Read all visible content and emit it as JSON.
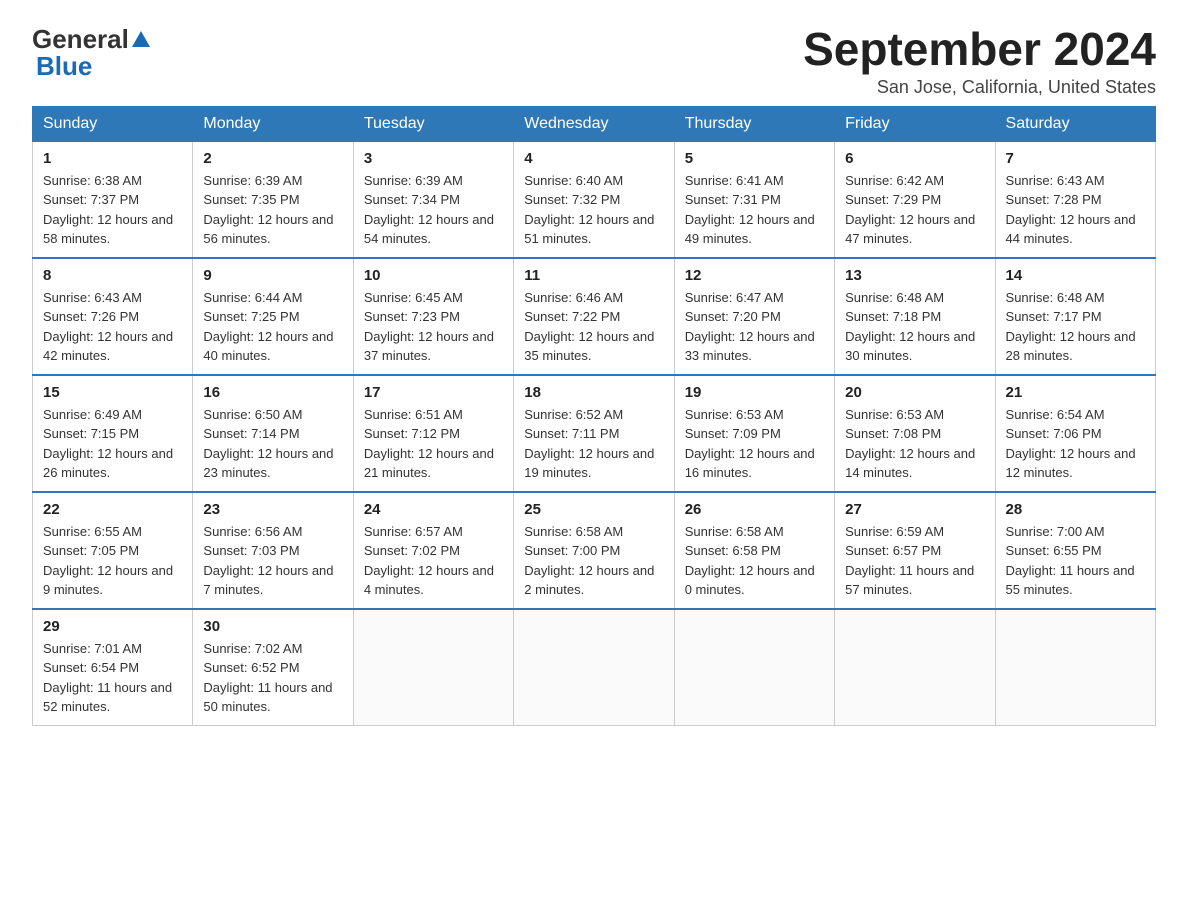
{
  "header": {
    "logo_general": "General",
    "logo_blue": "Blue",
    "month_title": "September 2024",
    "location": "San Jose, California, United States"
  },
  "days_of_week": [
    "Sunday",
    "Monday",
    "Tuesday",
    "Wednesday",
    "Thursday",
    "Friday",
    "Saturday"
  ],
  "weeks": [
    [
      {
        "num": "1",
        "sunrise": "6:38 AM",
        "sunset": "7:37 PM",
        "daylight": "12 hours and 58 minutes."
      },
      {
        "num": "2",
        "sunrise": "6:39 AM",
        "sunset": "7:35 PM",
        "daylight": "12 hours and 56 minutes."
      },
      {
        "num": "3",
        "sunrise": "6:39 AM",
        "sunset": "7:34 PM",
        "daylight": "12 hours and 54 minutes."
      },
      {
        "num": "4",
        "sunrise": "6:40 AM",
        "sunset": "7:32 PM",
        "daylight": "12 hours and 51 minutes."
      },
      {
        "num": "5",
        "sunrise": "6:41 AM",
        "sunset": "7:31 PM",
        "daylight": "12 hours and 49 minutes."
      },
      {
        "num": "6",
        "sunrise": "6:42 AM",
        "sunset": "7:29 PM",
        "daylight": "12 hours and 47 minutes."
      },
      {
        "num": "7",
        "sunrise": "6:43 AM",
        "sunset": "7:28 PM",
        "daylight": "12 hours and 44 minutes."
      }
    ],
    [
      {
        "num": "8",
        "sunrise": "6:43 AM",
        "sunset": "7:26 PM",
        "daylight": "12 hours and 42 minutes."
      },
      {
        "num": "9",
        "sunrise": "6:44 AM",
        "sunset": "7:25 PM",
        "daylight": "12 hours and 40 minutes."
      },
      {
        "num": "10",
        "sunrise": "6:45 AM",
        "sunset": "7:23 PM",
        "daylight": "12 hours and 37 minutes."
      },
      {
        "num": "11",
        "sunrise": "6:46 AM",
        "sunset": "7:22 PM",
        "daylight": "12 hours and 35 minutes."
      },
      {
        "num": "12",
        "sunrise": "6:47 AM",
        "sunset": "7:20 PM",
        "daylight": "12 hours and 33 minutes."
      },
      {
        "num": "13",
        "sunrise": "6:48 AM",
        "sunset": "7:18 PM",
        "daylight": "12 hours and 30 minutes."
      },
      {
        "num": "14",
        "sunrise": "6:48 AM",
        "sunset": "7:17 PM",
        "daylight": "12 hours and 28 minutes."
      }
    ],
    [
      {
        "num": "15",
        "sunrise": "6:49 AM",
        "sunset": "7:15 PM",
        "daylight": "12 hours and 26 minutes."
      },
      {
        "num": "16",
        "sunrise": "6:50 AM",
        "sunset": "7:14 PM",
        "daylight": "12 hours and 23 minutes."
      },
      {
        "num": "17",
        "sunrise": "6:51 AM",
        "sunset": "7:12 PM",
        "daylight": "12 hours and 21 minutes."
      },
      {
        "num": "18",
        "sunrise": "6:52 AM",
        "sunset": "7:11 PM",
        "daylight": "12 hours and 19 minutes."
      },
      {
        "num": "19",
        "sunrise": "6:53 AM",
        "sunset": "7:09 PM",
        "daylight": "12 hours and 16 minutes."
      },
      {
        "num": "20",
        "sunrise": "6:53 AM",
        "sunset": "7:08 PM",
        "daylight": "12 hours and 14 minutes."
      },
      {
        "num": "21",
        "sunrise": "6:54 AM",
        "sunset": "7:06 PM",
        "daylight": "12 hours and 12 minutes."
      }
    ],
    [
      {
        "num": "22",
        "sunrise": "6:55 AM",
        "sunset": "7:05 PM",
        "daylight": "12 hours and 9 minutes."
      },
      {
        "num": "23",
        "sunrise": "6:56 AM",
        "sunset": "7:03 PM",
        "daylight": "12 hours and 7 minutes."
      },
      {
        "num": "24",
        "sunrise": "6:57 AM",
        "sunset": "7:02 PM",
        "daylight": "12 hours and 4 minutes."
      },
      {
        "num": "25",
        "sunrise": "6:58 AM",
        "sunset": "7:00 PM",
        "daylight": "12 hours and 2 minutes."
      },
      {
        "num": "26",
        "sunrise": "6:58 AM",
        "sunset": "6:58 PM",
        "daylight": "12 hours and 0 minutes."
      },
      {
        "num": "27",
        "sunrise": "6:59 AM",
        "sunset": "6:57 PM",
        "daylight": "11 hours and 57 minutes."
      },
      {
        "num": "28",
        "sunrise": "7:00 AM",
        "sunset": "6:55 PM",
        "daylight": "11 hours and 55 minutes."
      }
    ],
    [
      {
        "num": "29",
        "sunrise": "7:01 AM",
        "sunset": "6:54 PM",
        "daylight": "11 hours and 52 minutes."
      },
      {
        "num": "30",
        "sunrise": "7:02 AM",
        "sunset": "6:52 PM",
        "daylight": "11 hours and 50 minutes."
      },
      null,
      null,
      null,
      null,
      null
    ]
  ]
}
